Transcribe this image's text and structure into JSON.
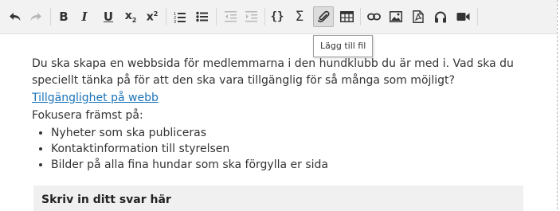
{
  "toolbar": {
    "buttons": [
      {
        "name": "undo-button",
        "icon": "undo-icon"
      },
      {
        "name": "redo-button",
        "icon": "redo-icon",
        "disabled": true
      },
      {
        "name": "bold-button",
        "icon": "bold-icon",
        "glyph": "B"
      },
      {
        "name": "italic-button",
        "icon": "italic-icon",
        "glyph": "I"
      },
      {
        "name": "underline-button",
        "icon": "underline-icon",
        "glyph": "U"
      },
      {
        "name": "subscript-button",
        "icon": "subscript-icon",
        "glyph": "x",
        "sub": "2"
      },
      {
        "name": "superscript-button",
        "icon": "superscript-icon",
        "glyph": "x",
        "sup": "2"
      },
      {
        "name": "ordered-list-button",
        "icon": "ordered-list-icon"
      },
      {
        "name": "bullet-list-button",
        "icon": "bullet-list-icon"
      },
      {
        "name": "outdent-button",
        "icon": "outdent-icon",
        "disabled": true
      },
      {
        "name": "indent-button",
        "icon": "indent-icon",
        "disabled": true
      },
      {
        "name": "code-button",
        "icon": "code-braces-icon",
        "glyph": "{}"
      },
      {
        "name": "formula-button",
        "icon": "sigma-icon",
        "glyph": "Σ"
      },
      {
        "name": "attach-file-button",
        "icon": "paperclip-icon",
        "active": true
      },
      {
        "name": "table-button",
        "icon": "table-icon"
      },
      {
        "name": "link-button",
        "icon": "link-icon"
      },
      {
        "name": "image-button",
        "icon": "image-icon"
      },
      {
        "name": "pdf-button",
        "icon": "pdf-icon"
      },
      {
        "name": "audio-button",
        "icon": "headphones-icon"
      },
      {
        "name": "video-button",
        "icon": "video-camera-icon"
      }
    ],
    "tooltip": "Lägg till fil"
  },
  "content": {
    "paragraph": "Du ska skapa en webbsida för medlemmarna i den hundklubb du är med i. Vad ska du speciellt tänka på för att den ska vara tillgänglig för så många som möjligt?",
    "link_text": "Tillgänglighet på webb",
    "focus_label": "Fokusera främst på:",
    "bullets": [
      "Nyheter som ska publiceras",
      "Kontaktinformation till styrelsen",
      "Bilder på alla fina hundar som ska förgylla er sida"
    ]
  },
  "answer": {
    "label": "Skriv in ditt svar här"
  },
  "colors": {
    "toolbar_bg": "#f2f2f2",
    "link": "#1a73b8",
    "text": "#333333",
    "answer_bg": "#f0f0f0"
  }
}
